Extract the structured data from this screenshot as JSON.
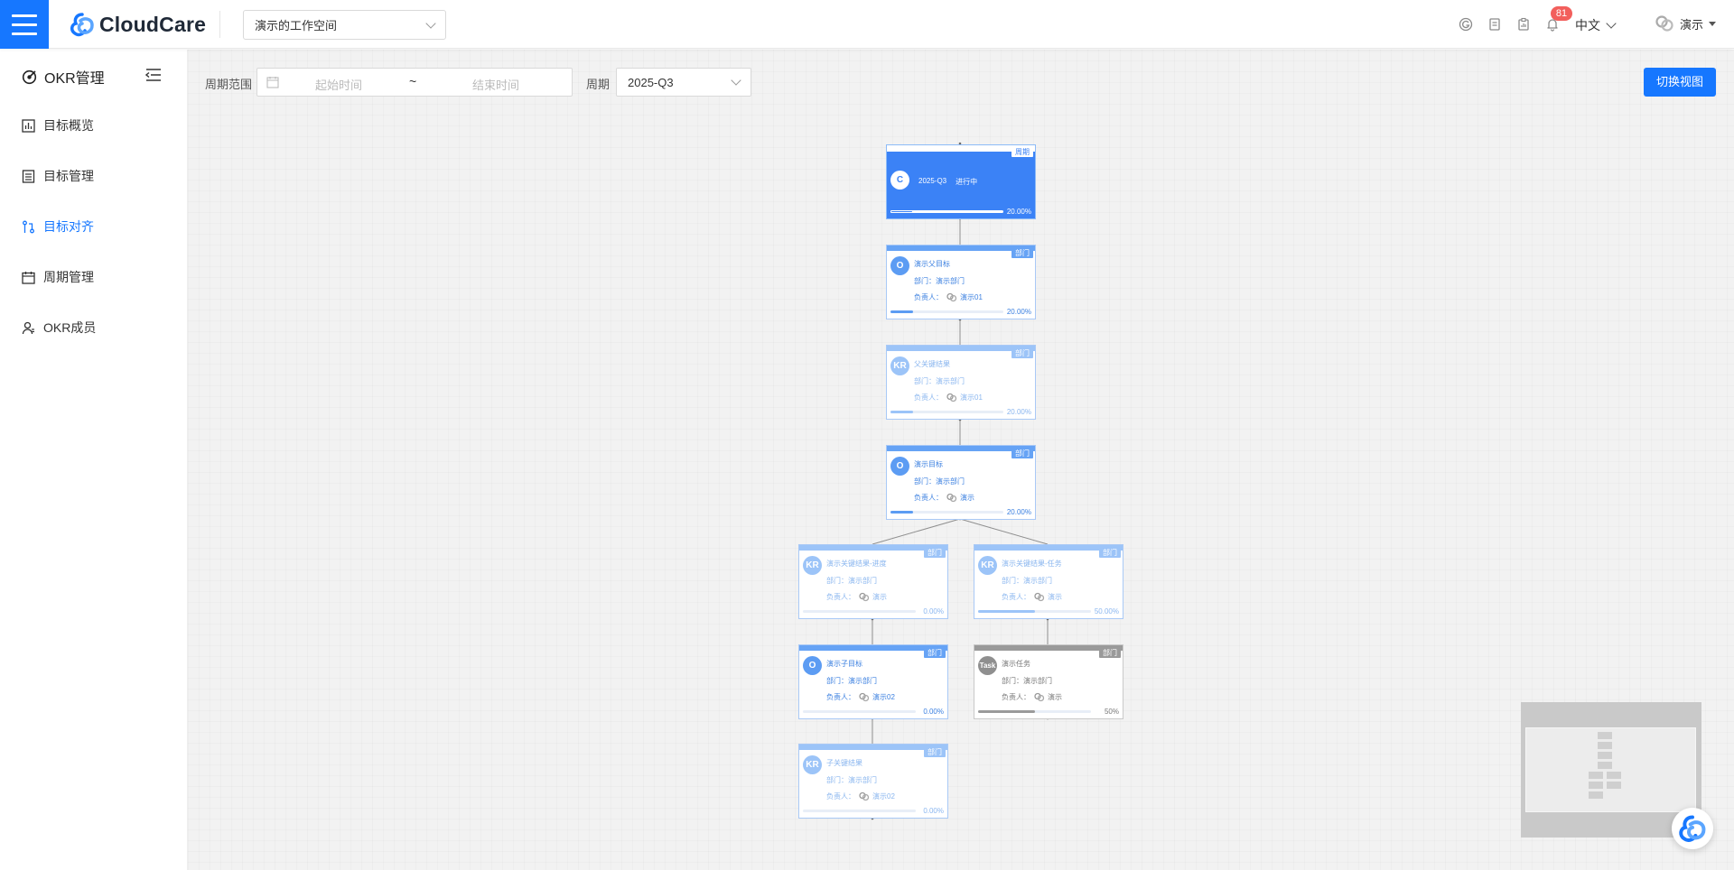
{
  "app": {
    "brand": "CloudCare",
    "workspace": "演示的工作空间",
    "notifications_count": "81",
    "language": "中文",
    "user_name": "演示",
    "icons": [
      "grid-apps-icon",
      "document-icon",
      "report-icon",
      "bell-icon"
    ]
  },
  "sidebar": {
    "title": "OKR管理",
    "items": [
      {
        "label": "目标概览",
        "icon": "chart-icon",
        "active": false
      },
      {
        "label": "目标管理",
        "icon": "list-icon",
        "active": false
      },
      {
        "label": "目标对齐",
        "icon": "align-icon",
        "active": true
      },
      {
        "label": "周期管理",
        "icon": "calendar-icon",
        "active": false
      },
      {
        "label": "OKR成员",
        "icon": "member-icon",
        "active": false
      }
    ]
  },
  "filters": {
    "range_label": "周期范围",
    "start_placeholder": "起始时间",
    "separator": "~",
    "end_placeholder": "结束时间",
    "period_label": "周期",
    "period_value": "2025-Q3",
    "switch_button": "切换视图"
  },
  "tree": {
    "cycle": {
      "tag": "周期",
      "avatar": "C",
      "name": "2025-Q3",
      "status": "进行中",
      "progress": 0.2,
      "progress_text": "20.00%"
    },
    "nodes": [
      {
        "key": "parent-objective",
        "type": "O",
        "tag": "部门",
        "title": "演示父目标",
        "dept": "部门：演示部门",
        "owner_label": "负责人：",
        "owner": "演示01",
        "progress": 0.2,
        "progress_text": "20.00%"
      },
      {
        "key": "parent-kr",
        "type": "KR",
        "tag": "部门",
        "title": "父关键结果",
        "dept": "部门：演示部门",
        "owner_label": "负责人：",
        "owner": "演示01",
        "progress": 0.2,
        "progress_text": "20.00%"
      },
      {
        "key": "demo-objective",
        "type": "O",
        "tag": "部门",
        "title": "演示目标",
        "dept": "部门：演示部门",
        "owner_label": "负责人：",
        "owner": "演示",
        "progress": 0.2,
        "progress_text": "20.00%"
      },
      {
        "key": "kr-progress",
        "type": "KR",
        "tag": "部门",
        "title": "演示关键结果-进度",
        "dept": "部门：演示部门",
        "owner_label": "负责人：",
        "owner": "演示",
        "progress": 0,
        "progress_text": "0.00%"
      },
      {
        "key": "kr-task",
        "type": "KR",
        "tag": "部门",
        "title": "演示关键结果-任务",
        "dept": "部门：演示部门",
        "owner_label": "负责人：",
        "owner": "演示",
        "progress": 0.5,
        "progress_text": "50.00%"
      },
      {
        "key": "child-objective",
        "type": "O",
        "tag": "部门",
        "title": "演示子目标",
        "dept": "部门：演示部门",
        "owner_label": "负责人：",
        "owner": "演示02",
        "progress": 0,
        "progress_text": "0.00%"
      },
      {
        "key": "demo-task",
        "type": "Task",
        "tag": "部门",
        "title": "演示任务",
        "dept": "部门：演示部门",
        "owner_label": "负责人：",
        "owner": "演示",
        "progress": 0.5,
        "progress_text": "50%"
      },
      {
        "key": "child-kr",
        "type": "KR",
        "tag": "部门",
        "title": "子关键结果",
        "dept": "部门：演示部门",
        "owner_label": "负责人：",
        "owner": "演示02",
        "progress": 0,
        "progress_text": "0.00%"
      }
    ]
  }
}
